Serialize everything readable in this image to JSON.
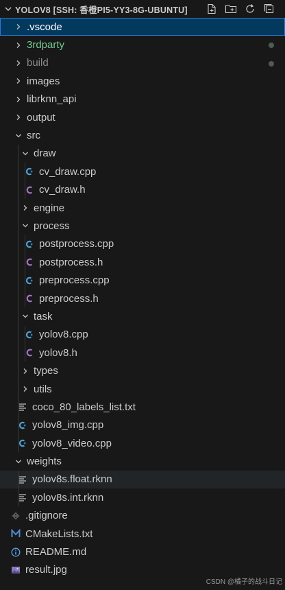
{
  "explorer": {
    "title": "YOLOV8 [SSH: 香橙PI5-YY3-8G-UBUNTU]",
    "actions": [
      "new-file-icon",
      "new-folder-icon",
      "refresh-icon",
      "collapse-all-icon"
    ]
  },
  "tree": [
    {
      "label": ".vscode",
      "type": "folder",
      "open": false,
      "depth": 0,
      "selected": true
    },
    {
      "label": "3rdparty",
      "type": "folder",
      "open": false,
      "depth": 0,
      "status": "green",
      "dot": true
    },
    {
      "label": "build",
      "type": "folder",
      "open": false,
      "depth": 0,
      "status": "dim",
      "dot": true
    },
    {
      "label": "images",
      "type": "folder",
      "open": false,
      "depth": 0
    },
    {
      "label": "librknn_api",
      "type": "folder",
      "open": false,
      "depth": 0
    },
    {
      "label": "output",
      "type": "folder",
      "open": false,
      "depth": 0
    },
    {
      "label": "src",
      "type": "folder",
      "open": true,
      "depth": 0
    },
    {
      "label": "draw",
      "type": "folder",
      "open": true,
      "depth": 1
    },
    {
      "label": "cv_draw.cpp",
      "type": "cpp",
      "depth": 2
    },
    {
      "label": "cv_draw.h",
      "type": "h",
      "depth": 2
    },
    {
      "label": "engine",
      "type": "folder",
      "open": false,
      "depth": 1
    },
    {
      "label": "process",
      "type": "folder",
      "open": true,
      "depth": 1
    },
    {
      "label": "postprocess.cpp",
      "type": "cpp",
      "depth": 2
    },
    {
      "label": "postprocess.h",
      "type": "h",
      "depth": 2
    },
    {
      "label": "preprocess.cpp",
      "type": "cpp",
      "depth": 2
    },
    {
      "label": "preprocess.h",
      "type": "h",
      "depth": 2
    },
    {
      "label": "task",
      "type": "folder",
      "open": true,
      "depth": 1
    },
    {
      "label": "yolov8.cpp",
      "type": "cpp",
      "depth": 2
    },
    {
      "label": "yolov8.h",
      "type": "h",
      "depth": 2
    },
    {
      "label": "types",
      "type": "folder",
      "open": false,
      "depth": 1
    },
    {
      "label": "utils",
      "type": "folder",
      "open": false,
      "depth": 1
    },
    {
      "label": "coco_80_labels_list.txt",
      "type": "txt",
      "depth": 1
    },
    {
      "label": "yolov8_img.cpp",
      "type": "cpp",
      "depth": 1
    },
    {
      "label": "yolov8_video.cpp",
      "type": "cpp",
      "depth": 1
    },
    {
      "label": "weights",
      "type": "folder",
      "open": true,
      "depth": 0
    },
    {
      "label": "yolov8s.float.rknn",
      "type": "txt",
      "depth": 1,
      "hover": true
    },
    {
      "label": "yolov8s.int.rknn",
      "type": "txt",
      "depth": 1
    },
    {
      "label": ".gitignore",
      "type": "git",
      "depth": 0
    },
    {
      "label": "CMakeLists.txt",
      "type": "cmake",
      "depth": 0
    },
    {
      "label": "README.md",
      "type": "info",
      "depth": 0
    },
    {
      "label": "result.jpg",
      "type": "image",
      "depth": 0
    }
  ],
  "watermark": "CSDN @橘子的战斗日记",
  "colors": {
    "selected_bg": "#04395e",
    "selected_border": "#2b79d6",
    "untracked": "#73c991",
    "ignored": "#8b8b8b",
    "cpp_icon": "#4ea0d8",
    "h_icon": "#a074c4"
  }
}
